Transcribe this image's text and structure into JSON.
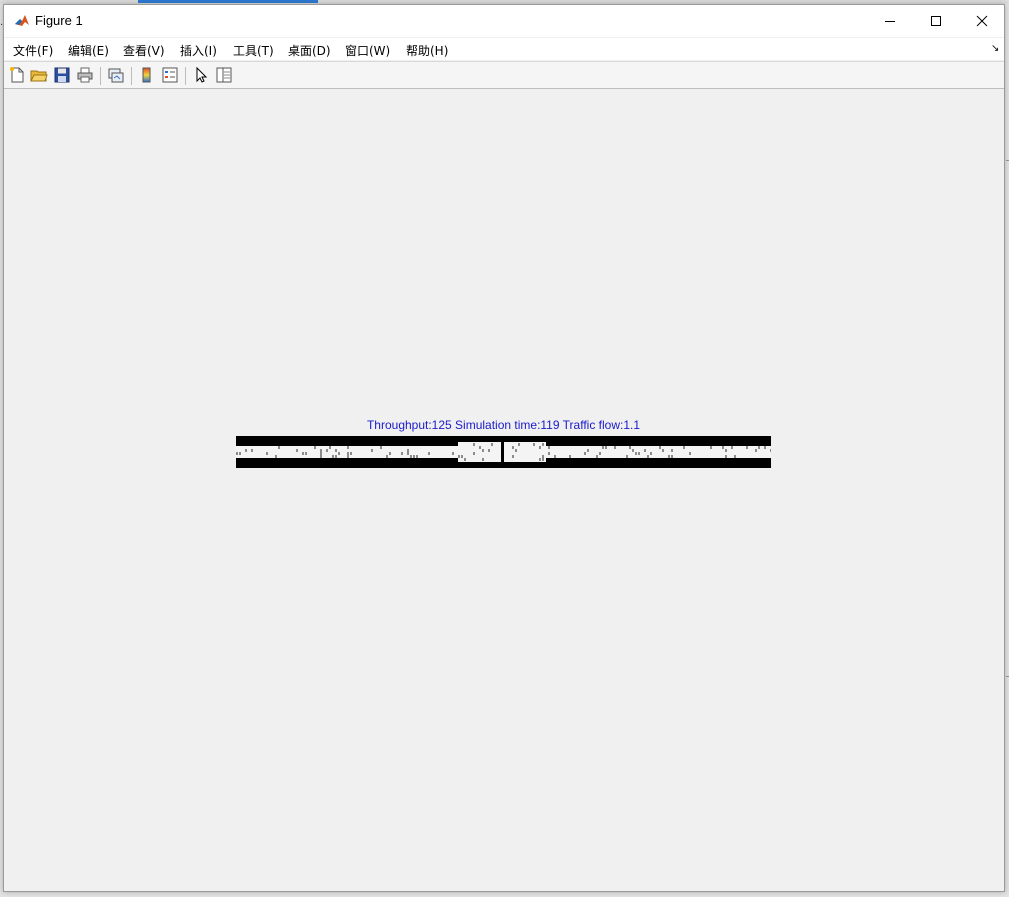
{
  "window": {
    "title": "Figure 1"
  },
  "menu": {
    "items": [
      {
        "label": "文件(F)"
      },
      {
        "label": "编辑(E)"
      },
      {
        "label": "查看(V)"
      },
      {
        "label": "插入(I)"
      },
      {
        "label": "工具(T)"
      },
      {
        "label": "桌面(D)"
      },
      {
        "label": "窗口(W)"
      },
      {
        "label": "帮助(H)"
      }
    ],
    "overflow_icon": "↘"
  },
  "toolbar": {
    "icons": [
      "new-figure-icon",
      "open-file-icon",
      "save-icon",
      "print-icon",
      "link-plot-icon",
      "colorbar-icon",
      "legend-icon",
      "edit-plot-cursor-icon",
      "property-inspector-icon"
    ]
  },
  "plot": {
    "title": "Throughput:125  Simulation time:119  Traffic flow:1.1"
  },
  "colors": {
    "title_text": "#1a1acc",
    "road_border": "#000000",
    "road_lane": "#f4f4f4",
    "vehicle": "#8c8c8c"
  }
}
